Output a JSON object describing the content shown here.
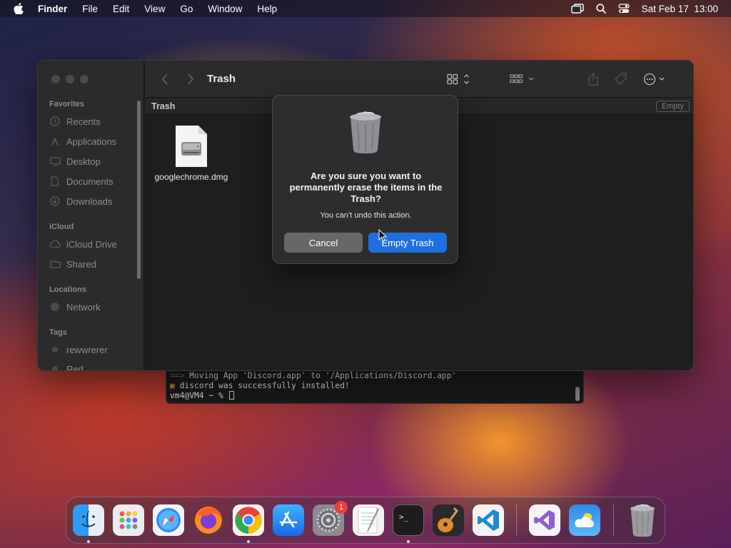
{
  "menubar": {
    "app": "Finder",
    "items": [
      "File",
      "Edit",
      "View",
      "Go",
      "Window",
      "Help"
    ],
    "datetime": "Sat Feb 17  13:00"
  },
  "finder": {
    "title": "Trash",
    "path_label": "Trash",
    "empty_button": "Empty",
    "sidebar": {
      "favorites_header": "Favorites",
      "favorites": [
        "Recents",
        "Applications",
        "Desktop",
        "Documents",
        "Downloads"
      ],
      "icloud_header": "iCloud",
      "icloud": [
        "iCloud Drive",
        "Shared"
      ],
      "locations_header": "Locations",
      "locations": [
        "Network"
      ],
      "tags_header": "Tags",
      "tags": [
        {
          "label": "rewwrerer",
          "color": "#4a4a4c"
        },
        {
          "label": "Red",
          "color": "#4a4a4c"
        }
      ]
    },
    "files": [
      {
        "name": "googlechrome.dmg",
        "icon": "dmg-disk-image-icon"
      }
    ]
  },
  "terminal": {
    "line1_prefix": "==>",
    "line1": "Moving App 'Discord.app' to '/Applications/Discord.app'",
    "line2": "discord was successfully installed!",
    "prompt": "vm4@VM4 ~ %"
  },
  "alert": {
    "icon": "trash-full-icon",
    "question": "Are you sure you want to permanently erase the items in the Trash?",
    "detail": "You can’t undo this action.",
    "cancel": "Cancel",
    "confirm": "Empty Trash"
  },
  "dock": {
    "items": [
      "Finder",
      "Launchpad",
      "Safari",
      "Firefox",
      "Google Chrome",
      "App Store",
      "System Settings",
      "TextEdit",
      "Terminal",
      "GarageBand",
      "Visual Studio Code",
      "Visual Studio",
      "Weather",
      "Trash"
    ],
    "system_settings_badge": "1"
  },
  "colors": {
    "accent": "#1f6fdf",
    "cancel_button": "#676669",
    "badge": "#e8403a"
  }
}
